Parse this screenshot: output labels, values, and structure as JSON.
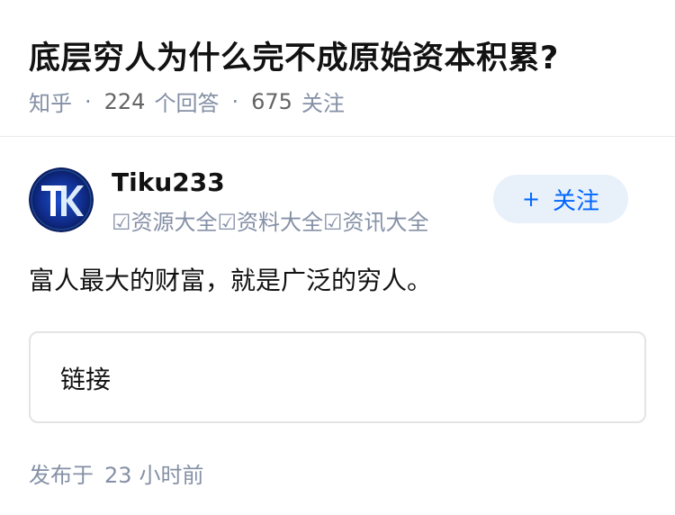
{
  "question": {
    "title": "底层穷人为什么完不成原始资本积累?",
    "source": "知乎",
    "separator": "·",
    "answer_count": "224",
    "answer_label": "个回答",
    "follower_count": "675",
    "follower_label": "关注"
  },
  "author": {
    "name": "Tiku233",
    "bio": "☑资源大全☑资料大全☑资讯大全",
    "avatar_icon": "tk-logo-icon",
    "avatar_colors": {
      "outer": "#0a1a5c",
      "inner": "#1d4fd0",
      "glow": "#4fc3ff"
    }
  },
  "follow_button": {
    "plus": "+",
    "label": "关注",
    "bg_color": "#e8f0fa",
    "text_color": "#0066ff"
  },
  "answer": {
    "content": "富人最大的财富，就是广泛的穷人。"
  },
  "link_card": {
    "label": "链接"
  },
  "footer": {
    "published_prefix": "发布于",
    "published_value": "23",
    "published_suffix": "小时前"
  }
}
